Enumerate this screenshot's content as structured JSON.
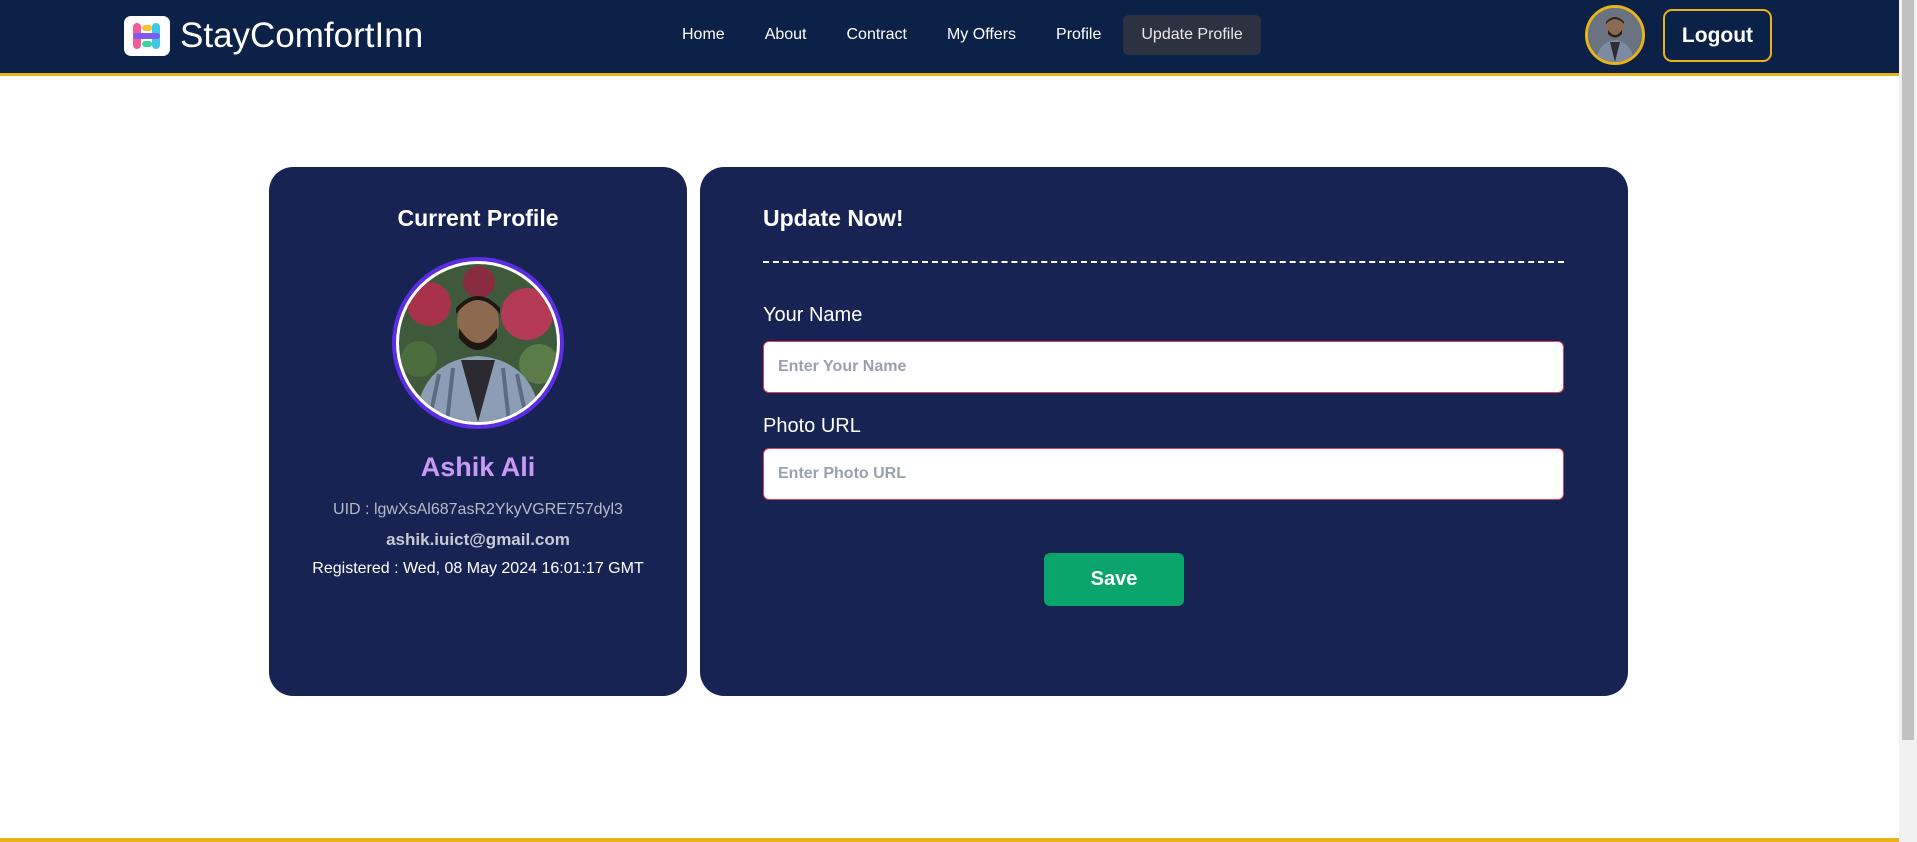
{
  "brand": {
    "name": "StayComfortInn",
    "logo_icon": "app-logo-icon"
  },
  "nav": {
    "links": [
      {
        "label": "Home"
      },
      {
        "label": "About"
      },
      {
        "label": "Contract"
      },
      {
        "label": "My Offers"
      },
      {
        "label": "Profile"
      },
      {
        "label": "Update Profile",
        "active": true
      }
    ],
    "logout_label": "Logout"
  },
  "profile": {
    "title": "Current Profile",
    "name": "Ashik Ali",
    "uid": "UID : lgwXsAl687asR2YkyVGRE757dyl3",
    "email": "ashik.iuict@gmail.com",
    "registered": "Registered : Wed, 08 May 2024 16:01:17 GMT"
  },
  "update": {
    "title": "Update Now!",
    "name_label": "Your Name",
    "name_value": "",
    "name_placeholder": "Enter Your Name",
    "photo_label": "Photo URL",
    "photo_value": "",
    "photo_placeholder": "Enter Photo URL",
    "save_label": "Save"
  },
  "colors": {
    "navbar_bg": "#0b2147",
    "accent_gold": "#e9b31a",
    "card_bg": "#172453",
    "name_purple": "#c89af5",
    "save_green": "#0aa56b"
  }
}
